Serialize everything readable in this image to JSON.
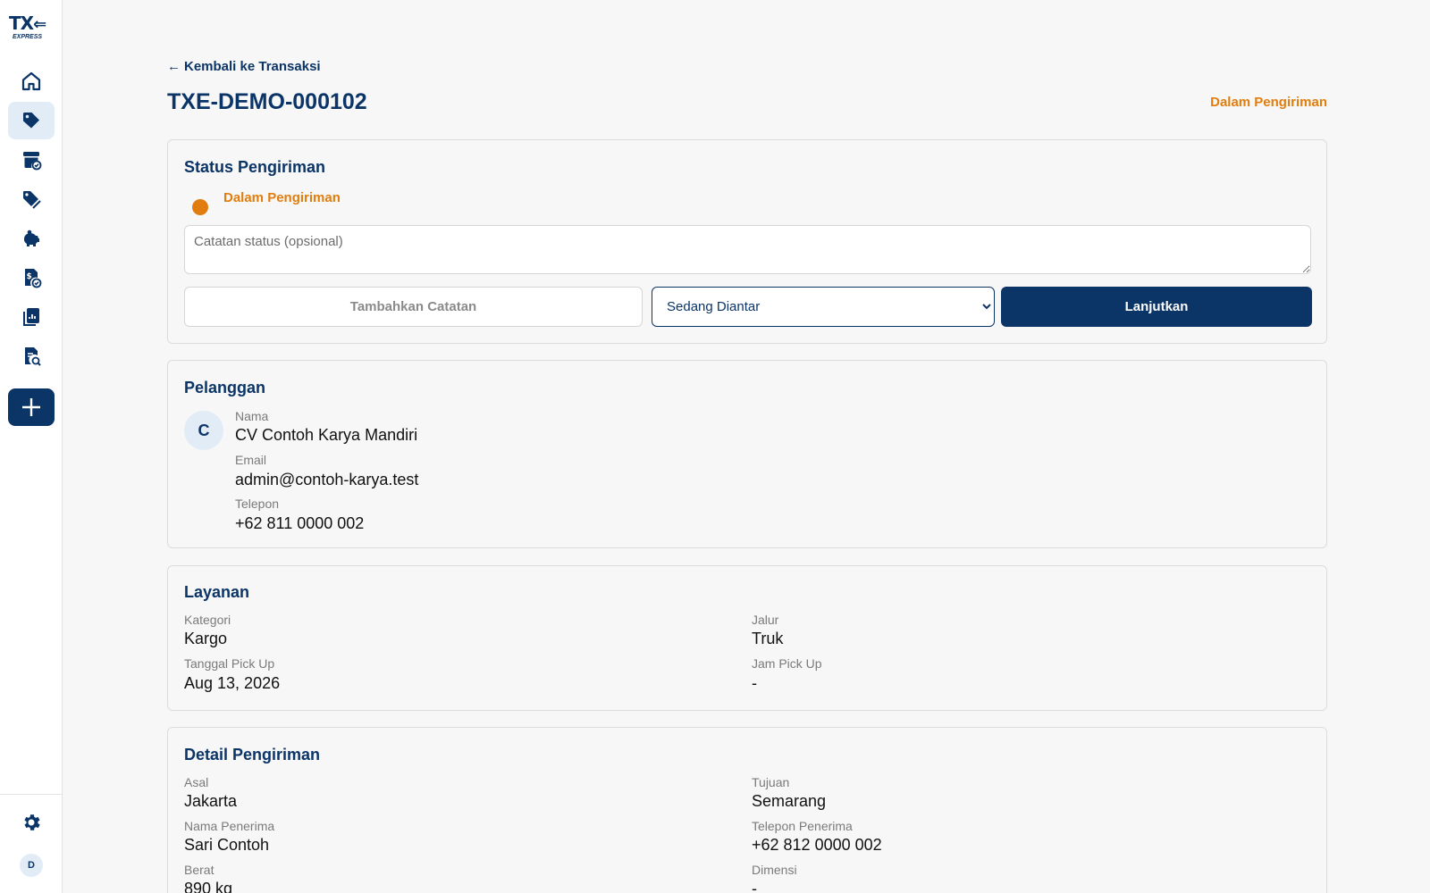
{
  "app": {
    "logo_text": "TX",
    "logo_sub": "EXPRESS"
  },
  "sidebar": {
    "items": [
      {
        "name": "home-icon"
      },
      {
        "name": "tag-icon",
        "active": true
      },
      {
        "name": "archive-check-icon"
      },
      {
        "name": "discount-tag-icon"
      },
      {
        "name": "piggy-bank-icon"
      },
      {
        "name": "invoice-check-icon"
      },
      {
        "name": "report-chart-icon"
      },
      {
        "name": "document-search-icon"
      },
      {
        "name": "plus-icon"
      }
    ],
    "settings_icon": "gear-icon",
    "user_initial": "D"
  },
  "header": {
    "back_label": "Kembali ke Transaksi",
    "title": "TXE-DEMO-000102",
    "status": "Dalam Pengiriman"
  },
  "status_card": {
    "title": "Status Pengiriman",
    "current_status": "Dalam Pengiriman",
    "note_placeholder": "Catatan status (opsional)",
    "add_note_label": "Tambahkan Catatan",
    "selected_next_status": "Sedang Diantar",
    "continue_label": "Lanjutkan"
  },
  "customer": {
    "title": "Pelanggan",
    "initial": "C",
    "name_label": "Nama",
    "name": "CV Contoh Karya Mandiri",
    "email_label": "Email",
    "email": "admin@contoh-karya.test",
    "phone_label": "Telepon",
    "phone": "+62 811 0000 002"
  },
  "service": {
    "title": "Layanan",
    "category_label": "Kategori",
    "category": "Kargo",
    "route_label": "Jalur",
    "route": "Truk",
    "pickup_date_label": "Tanggal Pick Up",
    "pickup_date": "Aug 13, 2026",
    "pickup_time_label": "Jam Pick Up",
    "pickup_time": "-"
  },
  "shipment": {
    "title": "Detail Pengiriman",
    "origin_label": "Asal",
    "origin": "Jakarta",
    "destination_label": "Tujuan",
    "destination": "Semarang",
    "recipient_label": "Nama Penerima",
    "recipient": "Sari Contoh",
    "recipient_phone_label": "Telepon Penerima",
    "recipient_phone": "+62 812 0000 002",
    "weight_label": "Berat",
    "weight": "890 kg",
    "dimension_label": "Dimensi",
    "dimension": "-"
  },
  "colors": {
    "primary": "#0b3467",
    "accent": "#e07d0e",
    "background": "#f7f7f7"
  }
}
